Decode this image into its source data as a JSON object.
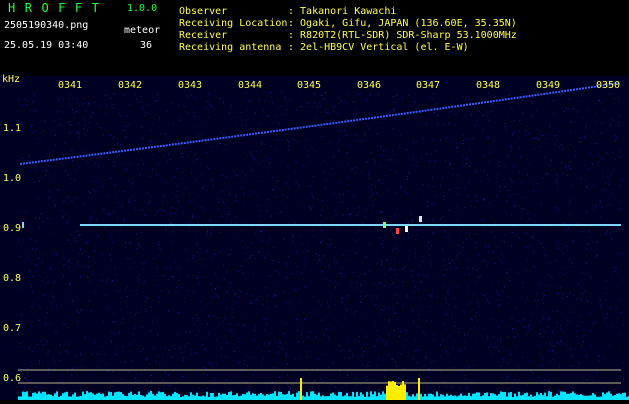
{
  "header": {
    "app_title": "HROFFT",
    "app_version": "1.0.0",
    "file_name": "2505190340.png",
    "timestamp": "25.05.19 03:40",
    "meteor_label": "meteor",
    "meteor_count": "36"
  },
  "station": [
    {
      "label": "Observer",
      "value": ": Takanori Kawachi"
    },
    {
      "label": "Receiving Location",
      "value": ": Ogaki, Gifu, JAPAN (136.60E, 35.35N)"
    },
    {
      "label": "Receiver",
      "value": ": R820T2(RTL-SDR) SDR-Sharp 53.1000MHz"
    },
    {
      "label": "Receiving antenna",
      "value": ": 2el-HB9CV Vertical (el. E-W)"
    }
  ],
  "spectrogram": {
    "unit_label": "kHz",
    "time_labels": [
      "0341",
      "0342",
      "0343",
      "0344",
      "0345",
      "0346",
      "0347",
      "0348",
      "0349",
      "0350"
    ],
    "freq_labels": [
      "1.1",
      "1.0",
      "0.9",
      "0.8",
      "0.7",
      "0.6"
    ],
    "colors": {
      "background": "#000022",
      "noise": "#1a2bb0",
      "drift_line": "#3a5dff",
      "beacon_line": "#7fd7ff",
      "spectrum": "#00e5ff",
      "spike": "#ffee00",
      "label": "#ffff44",
      "guide_line": "#e8e0a0"
    }
  }
}
